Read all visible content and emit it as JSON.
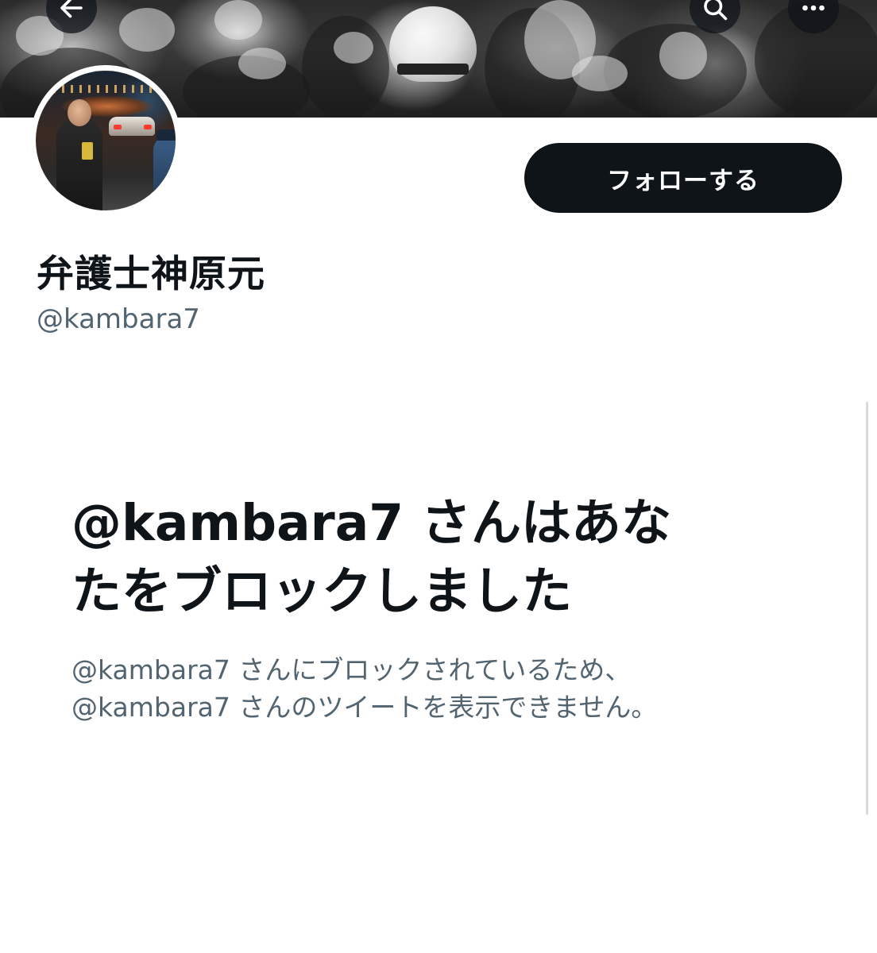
{
  "header": {
    "back_icon": "arrow-left-icon",
    "search_icon": "search-icon",
    "more_icon": "more-horizontal-icon"
  },
  "profile": {
    "display_name": "弁護士神原元",
    "handle": "@kambara7",
    "follow_label": "フォローする"
  },
  "blocked": {
    "title": "@kambara7 さんはあな\nたをブロックしました",
    "description": "@kambara7 さんにブロックされているため、\n@kambara7 さんのツイートを表示できません。"
  },
  "colors": {
    "text_primary": "#0f1419",
    "text_secondary": "#536471",
    "button_bg": "#0f1419",
    "button_text": "#ffffff",
    "background": "#ffffff"
  }
}
